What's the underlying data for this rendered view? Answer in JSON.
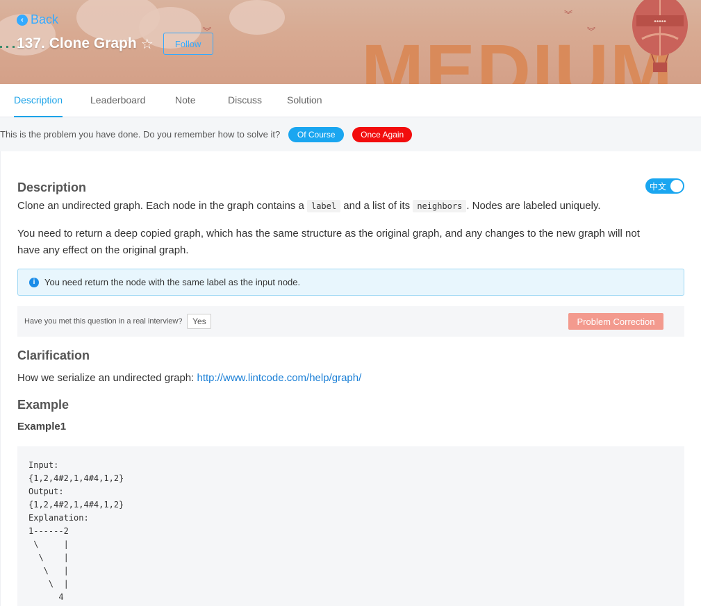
{
  "header": {
    "back_label": "Back",
    "title": "137. Clone Graph",
    "follow_label": "Follow",
    "banner_word": "MEDIUM"
  },
  "tabs": [
    {
      "label": "Description",
      "active": true
    },
    {
      "label": "Leaderboard",
      "active": false
    },
    {
      "label": "Note",
      "active": false
    },
    {
      "label": "Discuss",
      "active": false
    },
    {
      "label": "Solution",
      "active": false
    }
  ],
  "done_bar": {
    "message": "This is the problem you have done. Do you remember how to solve it?",
    "of_course_label": "Of Course",
    "once_again_label": "Once Again"
  },
  "description": {
    "heading": "Description",
    "lang_toggle_label": "中文",
    "p1_before": "Clone an undirected graph. Each node in the graph contains a ",
    "p1_code1": "label",
    "p1_middle": " and a list of its ",
    "p1_code2": "neighbors",
    "p1_after": ". Nodes are labeled uniquely.",
    "p2_line1": "You need to return a deep copied graph, which has the same structure as the original graph, and any changes to the new graph will not",
    "p2_line2": "have any effect on the original graph.",
    "note": "You need return the node with the same label as the input node."
  },
  "interview": {
    "question": "Have you met this question in a real interview?",
    "yes_label": "Yes",
    "correction_label": "Problem Correction"
  },
  "clarification": {
    "heading": "Clarification",
    "text": "How we serialize an undirected graph: ",
    "link": "http://www.lintcode.com/help/graph/"
  },
  "example": {
    "heading": "Example",
    "subheading": "Example1",
    "code": "Input:\n{1,2,4#2,1,4#4,1,2}\nOutput:\n{1,2,4#2,1,4#4,1,2}\nExplanation:\n1------2\n \\     |\n  \\    |\n   \\   |\n    \\  |\n      4"
  },
  "colors": {
    "accent": "#1ca3e8",
    "danger": "#f20d0d",
    "correction": "#f39a8e"
  }
}
